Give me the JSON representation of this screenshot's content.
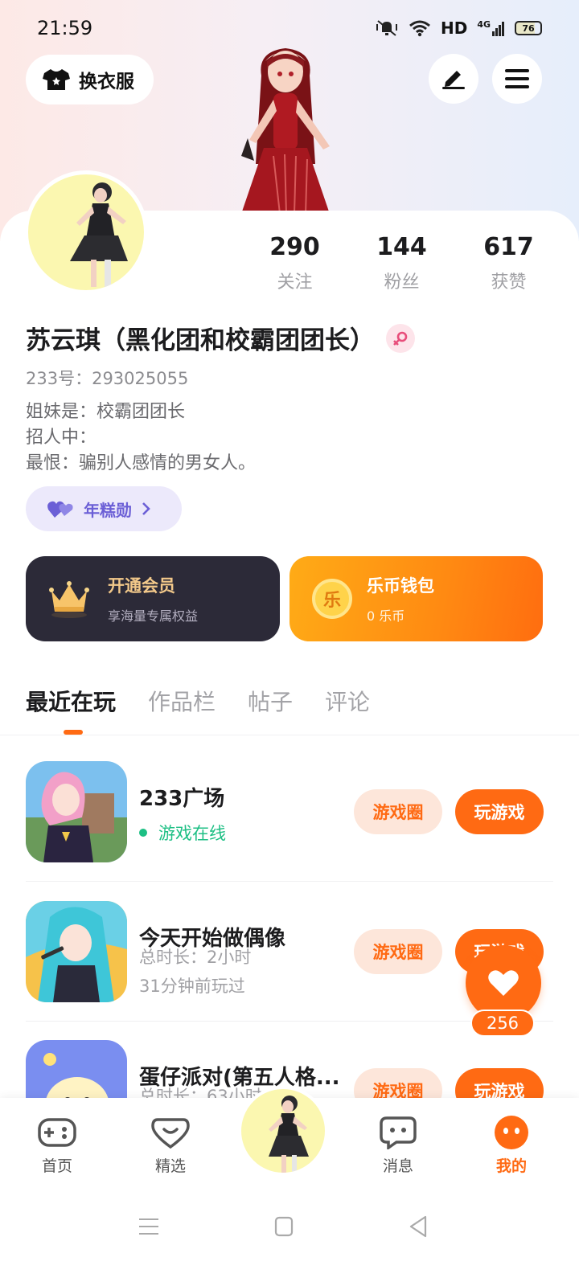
{
  "status_bar": {
    "time": "21:59",
    "network": "HD",
    "signal": "4G",
    "battery": "76"
  },
  "header": {
    "outfit_label": "换衣服"
  },
  "profile": {
    "stats": [
      {
        "value": "290",
        "label": "关注"
      },
      {
        "value": "144",
        "label": "粉丝"
      },
      {
        "value": "617",
        "label": "获赞"
      }
    ],
    "nickname": "苏云琪（黑化团和校霸团团长）",
    "uid": "233号：293025055",
    "bio_lines": [
      "姐妹是：校霸团团长",
      "招人中：",
      "最恨：骗别人感情的男女人。"
    ],
    "badge_label": "年糕勋"
  },
  "cards": {
    "vip": {
      "title": "开通会员",
      "subtitle": "享海量专属权益"
    },
    "wallet": {
      "title": "乐币钱包",
      "subtitle": "0 乐币",
      "coin_glyph": "乐"
    }
  },
  "tabs": [
    "最近在玩",
    "作品栏",
    "帖子",
    "评论"
  ],
  "games": [
    {
      "name": "233广场",
      "status": "游戏在线",
      "circle_label": "游戏圈",
      "play_label": "玩游戏"
    },
    {
      "name": "今天开始做偶像",
      "duration": "总时长：2小时",
      "last_played": "31分钟前玩过",
      "circle_label": "游戏圈",
      "play_label": "玩游戏"
    },
    {
      "name": "蛋仔派对(第五人格...",
      "duration": "总时长：63小时",
      "circle_label": "游戏圈",
      "play_label": "玩游戏"
    }
  ],
  "like": {
    "count": "256"
  },
  "bottom_nav": [
    {
      "label": "首页",
      "icon": "gamepad-icon"
    },
    {
      "label": "精选",
      "icon": "heart-chat-icon"
    },
    {
      "label": "",
      "icon": "avatar"
    },
    {
      "label": "消息",
      "icon": "message-icon"
    },
    {
      "label": "我的",
      "icon": "profile-face-icon"
    }
  ],
  "colors": {
    "accent": "#ff6a13",
    "vip_bg": "#2c2a38",
    "online": "#1dbf84"
  }
}
